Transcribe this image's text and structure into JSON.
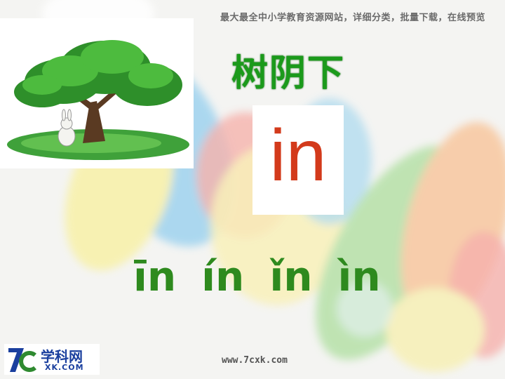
{
  "header": {
    "text": "最大最全中小学教育资源网站，详细分类，批量下载，在线预览"
  },
  "title": "树阴下",
  "syllable": "in",
  "tones": [
    "īn",
    "ín",
    "ǐn",
    "ìn"
  ],
  "logo": {
    "name": "学科网",
    "sub": "XK.COM"
  },
  "footer": {
    "url": "www.7cxk.com"
  },
  "colors": {
    "title": "#1b9a1b",
    "syllable": "#d33a1b",
    "tones": "#2e8a1e",
    "logo": "#1a3f9e"
  },
  "icons": [
    "tree-icon",
    "rabbit-icon",
    "logo-mark-icon"
  ]
}
